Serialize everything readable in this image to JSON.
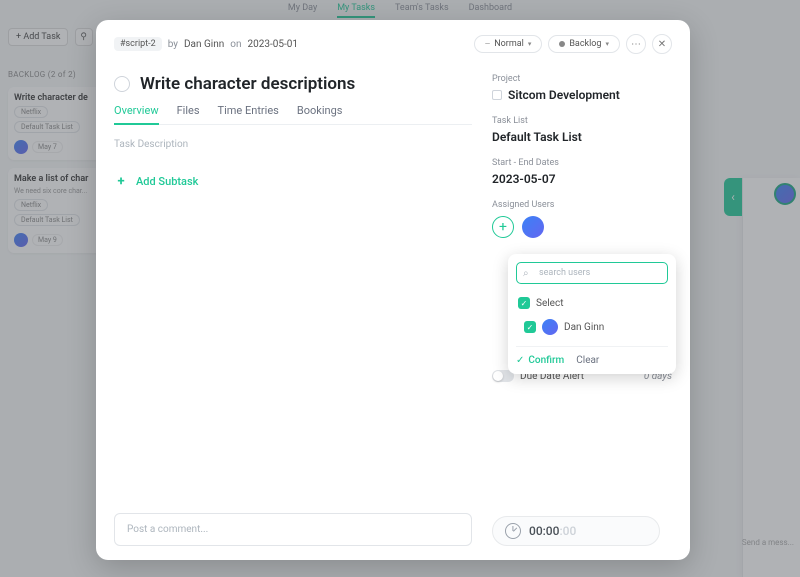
{
  "nav": {
    "items": [
      "My Day",
      "My Tasks",
      "Team's Tasks",
      "Dashboard"
    ],
    "activeIndex": 1
  },
  "bg": {
    "addTask": "Add Task",
    "backlog": "BACKLOG (2 of 2)",
    "card1": {
      "title": "Write character de",
      "chip1": "Netflix",
      "chip2": "Default Task List",
      "date": "May 7"
    },
    "card2": {
      "title": "Make a list of char",
      "sub": "We need six core char...",
      "chip1": "Netflix",
      "chip2": "Default Task List",
      "date": "May 9"
    },
    "send": "Send a mess..."
  },
  "modal": {
    "ref": "#script-2",
    "byPrefix": "by",
    "author": "Dan Ginn",
    "onPrefix": "on",
    "date": "2023-05-01",
    "priority": "Normal",
    "status": "Backlog",
    "title": "Write character descriptions",
    "tabs": [
      "Overview",
      "Files",
      "Time Entries",
      "Bookings"
    ],
    "descLabel": "Task Description",
    "addSubtask": "Add Subtask",
    "commentPlaceholder": "Post a comment..."
  },
  "side": {
    "projectLabel": "Project",
    "projectValue": "Sitcom Development",
    "taskListLabel": "Task List",
    "taskListValue": "Default Task List",
    "datesLabel": "Start - End Dates",
    "datesValue": "2023-05-07",
    "assignedLabel": "Assigned Users",
    "dueLabel": "Due Date Alert",
    "dueValue": "0 days",
    "timer": {
      "main": "00:00",
      "sec": ":00"
    }
  },
  "popover": {
    "searchPlaceholder": "search users",
    "selectLabel": "Select",
    "user": "Dan Ginn",
    "confirm": "Confirm",
    "clear": "Clear"
  }
}
